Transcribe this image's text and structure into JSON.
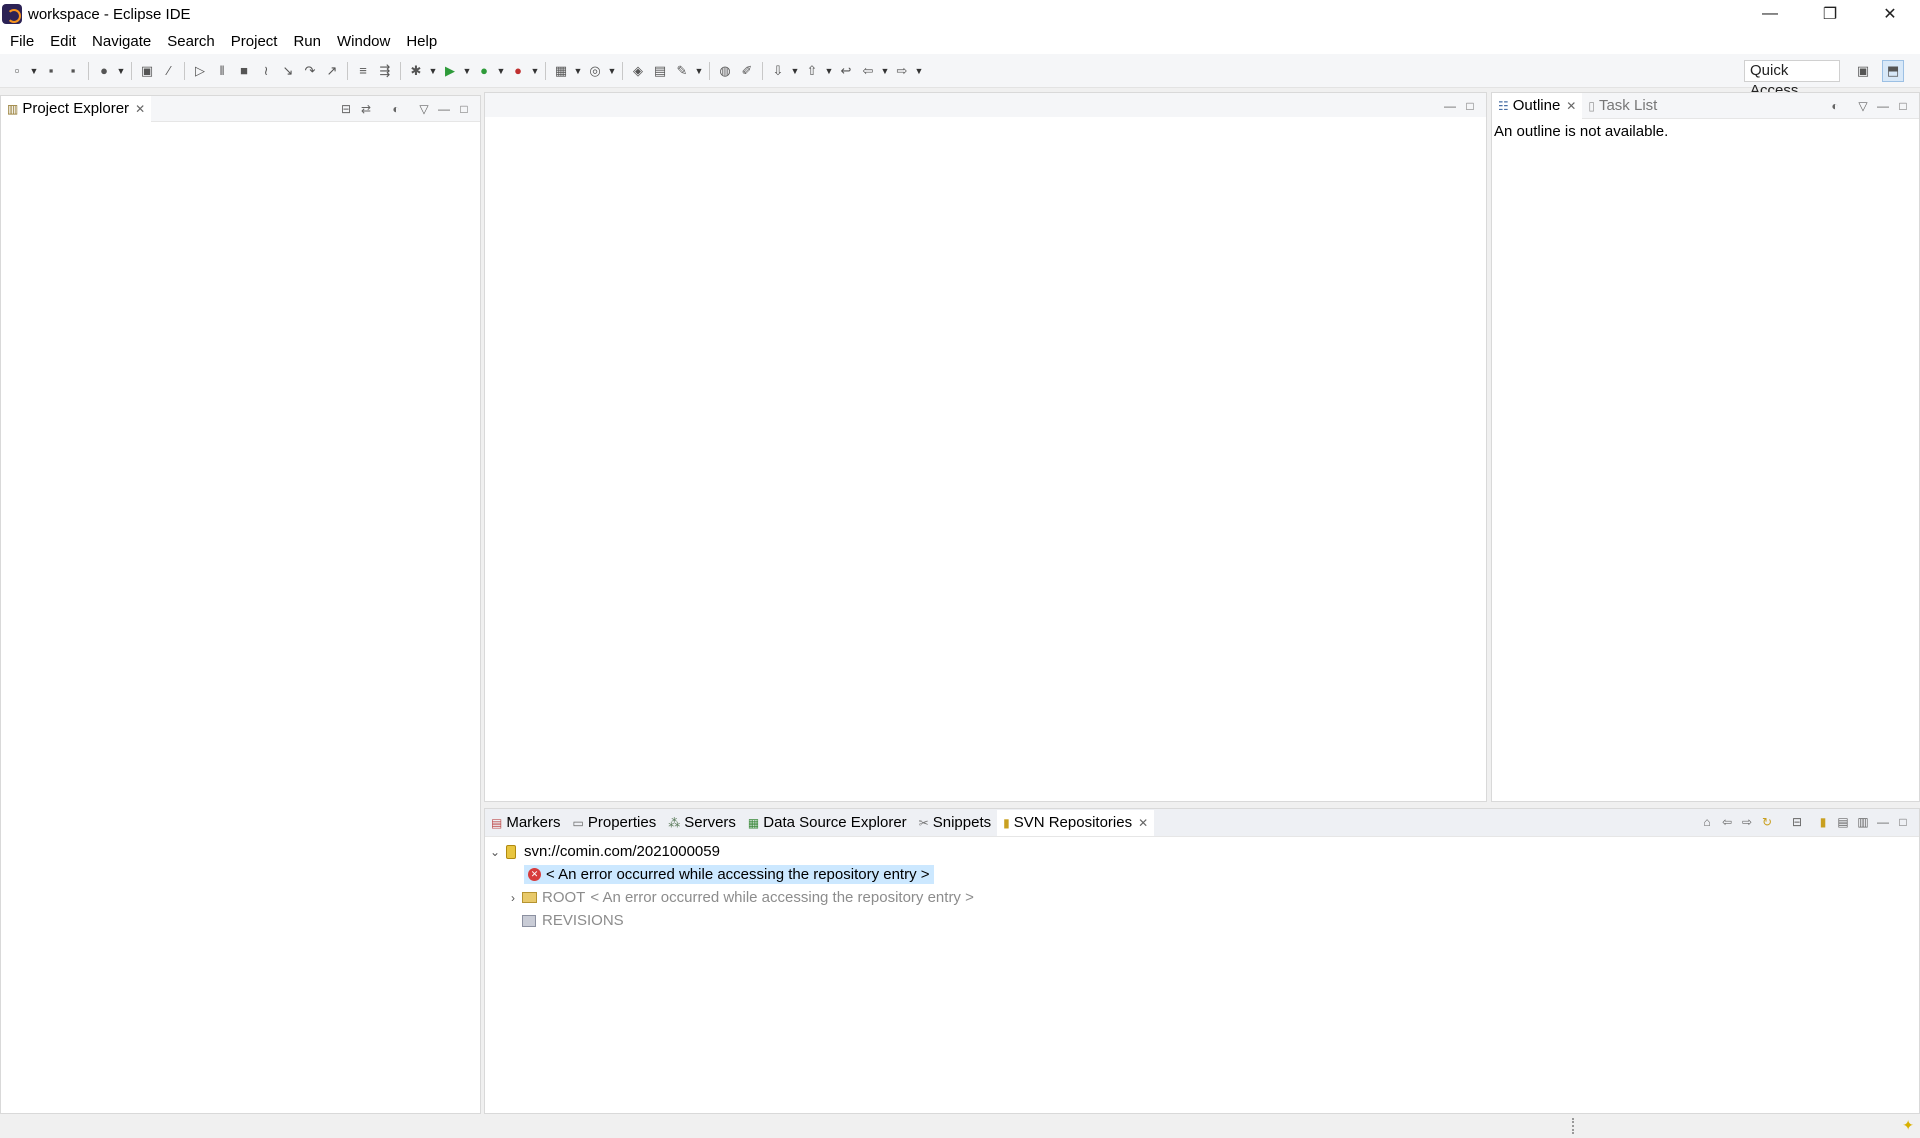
{
  "window": {
    "title": "workspace - Eclipse IDE",
    "controls": [
      "—",
      "❐",
      "✕"
    ]
  },
  "menu": [
    "File",
    "Edit",
    "Navigate",
    "Search",
    "Project",
    "Run",
    "Window",
    "Help"
  ],
  "toolbar": {
    "quick_access": "Quick Access"
  },
  "project_explorer": {
    "tab_label": "Project Explorer"
  },
  "outline": {
    "tab_label": "Outline",
    "task_list_label": "Task List",
    "message": "An outline is not available."
  },
  "bottom_panel": {
    "tabs": [
      "Markers",
      "Properties",
      "Servers",
      "Data Source Explorer",
      "Snippets",
      "SVN Repositories"
    ],
    "tree": {
      "repo_url": "svn://comin.com/2021000059",
      "error_entry": "< An error occurred while accessing the repository entry >",
      "root_label": "ROOT",
      "root_error": "< An error occurred while accessing the repository entry >",
      "revisions_label": "REVISIONS"
    }
  }
}
